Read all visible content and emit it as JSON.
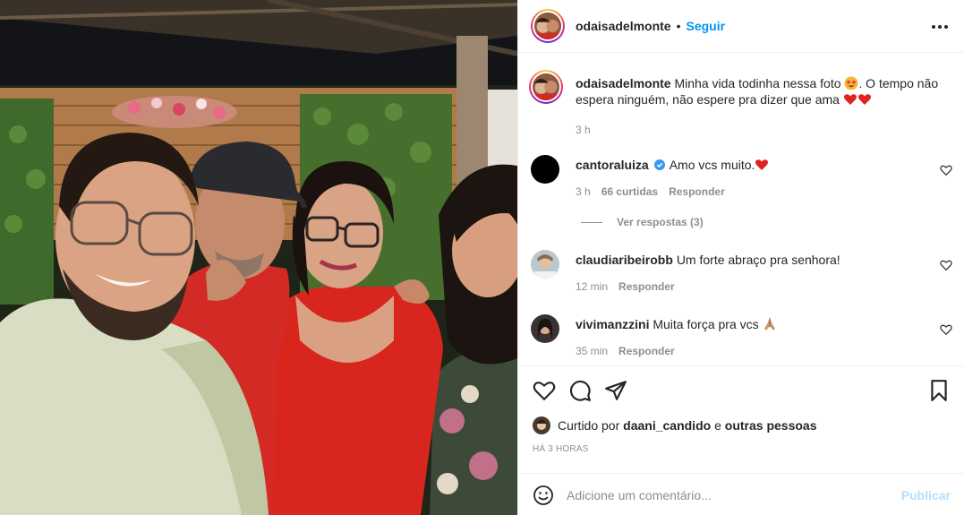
{
  "post": {
    "username": "odaisadelmonte",
    "follow_label": "Seguir",
    "dot": "•",
    "more_icon": "more-horizontal-icon"
  },
  "caption": {
    "username": "odaisadelmonte",
    "text_part1": "Minha vida todinha nessa foto",
    "text_part2": ". O tempo não espera ninguém, não espere pra dizer que ama",
    "time": "3 h"
  },
  "comments": [
    {
      "username": "cantoraluiza",
      "verified": true,
      "text": "Amo vcs muito.",
      "time": "3 h",
      "likes": "66 curtidas",
      "reply": "Responder",
      "view_replies": "Ver respostas (3)"
    },
    {
      "username": "claudiaribeirobb",
      "text": "Um forte abraço pra senhora!",
      "time": "12 min",
      "reply": "Responder"
    },
    {
      "username": "vivimanzzini",
      "text": "Muita força pra vcs",
      "time": "35 min",
      "reply": "Responder"
    }
  ],
  "likes": {
    "prefix": "Curtido por",
    "user": "daani_candido",
    "conj": "e",
    "others": "outras pessoas"
  },
  "timestamp": "HÁ 3 HORAS",
  "add_comment": {
    "placeholder": "Adicione um comentário...",
    "publish": "Publicar"
  },
  "colors": {
    "accent": "#0095f6",
    "publish_disabled": "#b2dffc",
    "heart": "#ed4956",
    "verified": "#3897f0"
  }
}
